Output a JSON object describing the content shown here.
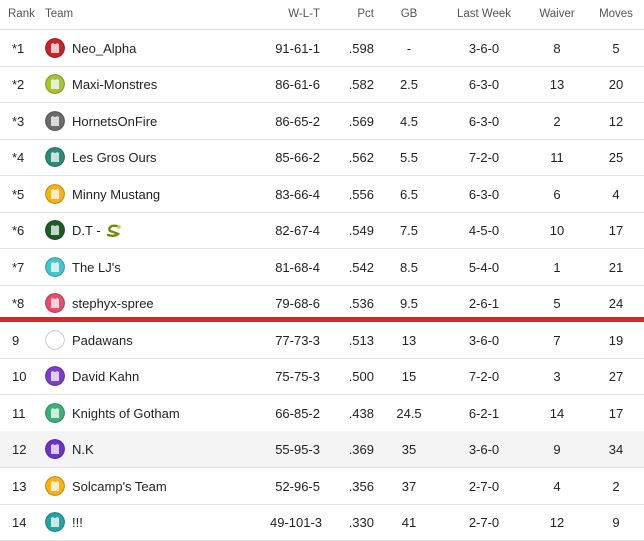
{
  "header": {
    "rank": "Rank",
    "team": "Team",
    "wlt": "W-L-T",
    "pct": "Pct",
    "gb": "GB",
    "last_week": "Last Week",
    "waiver": "Waiver",
    "moves": "Moves"
  },
  "rows": [
    {
      "rank": "*1",
      "team": "Neo_Alpha",
      "wlt": "91-61-1",
      "pct": ".598",
      "gb": "-",
      "last_week": "3-6-0",
      "waiver": "8",
      "moves": "5",
      "avatar": "red-rocket-avatar-icon",
      "avatar_color": "#c4242b"
    },
    {
      "rank": "*2",
      "team": "Maxi-Monstres",
      "wlt": "86-61-6",
      "pct": ".582",
      "gb": "2.5",
      "last_week": "6-3-0",
      "waiver": "13",
      "moves": "20",
      "avatar": "green-monster-avatar-icon",
      "avatar_color": "#a7c23a"
    },
    {
      "rank": "*3",
      "team": "HornetsOnFire",
      "wlt": "86-65-2",
      "pct": ".569",
      "gb": "4.5",
      "last_week": "6-3-0",
      "waiver": "2",
      "moves": "12",
      "avatar": "robot-avatar-icon",
      "avatar_color": "#6b6b6b"
    },
    {
      "rank": "*4",
      "team": "Les Gros Ours",
      "wlt": "85-66-2",
      "pct": ".562",
      "gb": "5.5",
      "last_week": "7-2-0",
      "waiver": "11",
      "moves": "25",
      "avatar": "bear-avatar-icon",
      "avatar_color": "#2f8a7a"
    },
    {
      "rank": "*5",
      "team": "Minny Mustang",
      "wlt": "83-66-4",
      "pct": ".556",
      "gb": "6.5",
      "last_week": "6-3-0",
      "waiver": "6",
      "moves": "4",
      "avatar": "jersey-avatar-icon",
      "avatar_color": "#f2b21b"
    },
    {
      "rank": "*6",
      "team": "D.T - ",
      "wlt": "82-67-4",
      "pct": ".549",
      "gb": "7.5",
      "last_week": "4-5-0",
      "waiver": "10",
      "moves": "17",
      "avatar": "dragon-avatar-icon",
      "avatar_color": "#1f5a2a"
    },
    {
      "rank": "*7",
      "team": "The LJ's",
      "wlt": "81-68-4",
      "pct": ".542",
      "gb": "8.5",
      "last_week": "5-4-0",
      "waiver": "1",
      "moves": "21",
      "avatar": "jersey-avatar-icon",
      "avatar_color": "#49c3c9"
    },
    {
      "rank": "*8",
      "team": "stephyx-spree",
      "wlt": "79-68-6",
      "pct": ".536",
      "gb": "9.5",
      "last_week": "2-6-1",
      "waiver": "5",
      "moves": "24",
      "avatar": "jersey-avatar-icon",
      "avatar_color": "#e0506f"
    },
    {
      "rank": "9",
      "team": "Padawans",
      "wlt": "77-73-3",
      "pct": ".513",
      "gb": "13",
      "last_week": "3-6-0",
      "waiver": "7",
      "moves": "19",
      "avatar": "figure-avatar-icon",
      "avatar_color": "#ffffff"
    },
    {
      "rank": "10",
      "team": "David Kahn",
      "wlt": "75-75-3",
      "pct": ".500",
      "gb": "15",
      "last_week": "7-2-0",
      "waiver": "3",
      "moves": "27",
      "avatar": "jersey-avatar-icon",
      "avatar_color": "#7b3fc7"
    },
    {
      "rank": "11",
      "team": "Knights of Gotham",
      "wlt": "66-85-2",
      "pct": ".438",
      "gb": "24.5",
      "last_week": "6-2-1",
      "waiver": "14",
      "moves": "17",
      "avatar": "jersey-avatar-icon",
      "avatar_color": "#3fae7a"
    },
    {
      "rank": "12",
      "team": "N.K",
      "wlt": "55-95-3",
      "pct": ".369",
      "gb": "35",
      "last_week": "3-6-0",
      "waiver": "9",
      "moves": "34",
      "avatar": "jersey-avatar-icon",
      "avatar_color": "#6a35c4"
    },
    {
      "rank": "13",
      "team": "Solcamp's Team",
      "wlt": "52-96-5",
      "pct": ".356",
      "gb": "37",
      "last_week": "2-7-0",
      "waiver": "4",
      "moves": "2",
      "avatar": "jersey-avatar-icon",
      "avatar_color": "#f2b21b"
    },
    {
      "rank": "14",
      "team": "!!!",
      "wlt": "49-101-3",
      "pct": ".330",
      "gb": "41",
      "last_week": "2-7-0",
      "waiver": "12",
      "moves": "9",
      "avatar": "jersey-avatar-icon",
      "avatar_color": "#2aa3a0"
    }
  ],
  "playoff_cutline_color": "#d9232d",
  "snake_icon": "snake-icon"
}
